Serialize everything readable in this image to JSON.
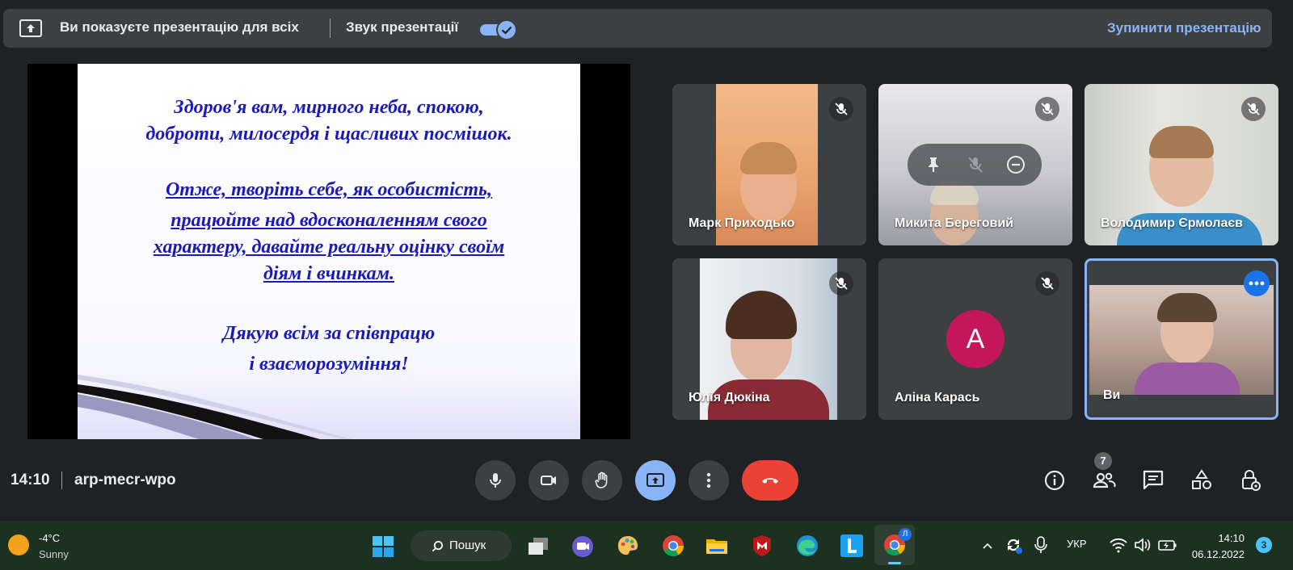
{
  "banner": {
    "presenting_text": "Ви показуєте презентацію для всіх",
    "audio_label": "Звук презентації",
    "audio_enabled": true,
    "stop_label": "Зупинити презентацію",
    "accent_color": "#8ab4f8"
  },
  "slide": {
    "lines": [
      "Здоров'я вам, мирного неба, спокою,",
      "доброти, милосердя  і щасливих посмішок.",
      "Отже, творіть себе, як особистість,",
      "працюйте над вдосконаленням свого",
      "характеру,  давайте реальну оцінку своїм",
      "діям і вчинкам.",
      "Дякую всім за співпрацю",
      "і взаєморозуміння!"
    ],
    "text_color": "#1a1ab8"
  },
  "participants": [
    {
      "name": "Марк Приходько",
      "muted": true
    },
    {
      "name": "Микита Береговий",
      "muted": true
    },
    {
      "name": "Володимир Єрмолаєв",
      "muted": true
    },
    {
      "name": "Юлія Дюкіна",
      "muted": true
    },
    {
      "name": "Аліна Карась",
      "muted": true,
      "avatar_letter": "A",
      "avatar_color": "#c2185b"
    },
    {
      "name": "Ви",
      "muted": false
    }
  ],
  "meeting": {
    "time": "14:10",
    "code": "arp-mecr-wpo",
    "people_count": "7",
    "end_call_color": "#ea4335"
  },
  "controls": [
    "microphone-icon",
    "camera-icon",
    "raise-hand-icon",
    "present-screen-icon",
    "more-options-icon",
    "end-call-icon"
  ],
  "right_controls": [
    "info-icon",
    "people-icon",
    "chat-icon",
    "activities-icon",
    "host-controls-icon"
  ],
  "taskbar": {
    "weather_temp": "-4°C",
    "weather_desc": "Sunny",
    "search_label": "Пошук",
    "language": "УКР",
    "time": "14:10",
    "date": "06.12.2022",
    "notifications_count": "3",
    "chrome_profile_letter": "Л"
  }
}
